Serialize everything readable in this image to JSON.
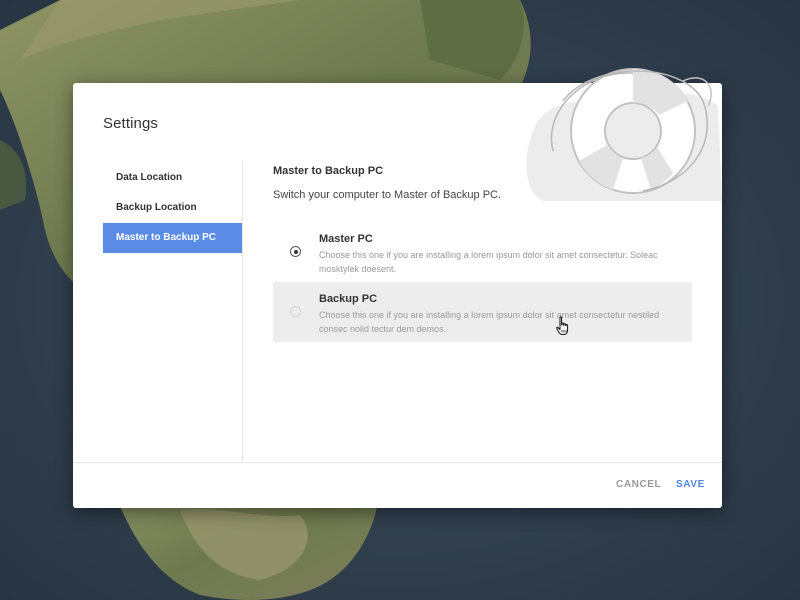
{
  "dialog": {
    "title": "Settings"
  },
  "sidebar": {
    "items": [
      {
        "label": "Data Location",
        "active": false
      },
      {
        "label": "Backup Location",
        "active": false
      },
      {
        "label": "Master to Backup PC",
        "active": true
      }
    ]
  },
  "content": {
    "title": "Master to Backup PC",
    "subtitle": "Switch your computer to Master of Backup PC.",
    "options": [
      {
        "title": "Master PC",
        "description": "Choose this one if you are installing a lorem ipsum dolor sit amet consectetur. Soleac mosktylek doesent.",
        "selected": true
      },
      {
        "title": "Backup PC",
        "description": "Choose this one if you are installing a lorem ipsum dolor sit amet consectetur nestiled consec nolid tectur dem demos.",
        "selected": false
      }
    ]
  },
  "footer": {
    "cancel_label": "CANCEL",
    "save_label": "SAVE"
  },
  "icons": {
    "illustration": "lifebuoy-icon",
    "pointer": "hand-pointer-cursor-icon"
  },
  "colors": {
    "accent": "#5a8ce6",
    "save_text": "#4f86e6",
    "hover_bg": "#ededed",
    "muted_text": "#9a9a9a"
  }
}
